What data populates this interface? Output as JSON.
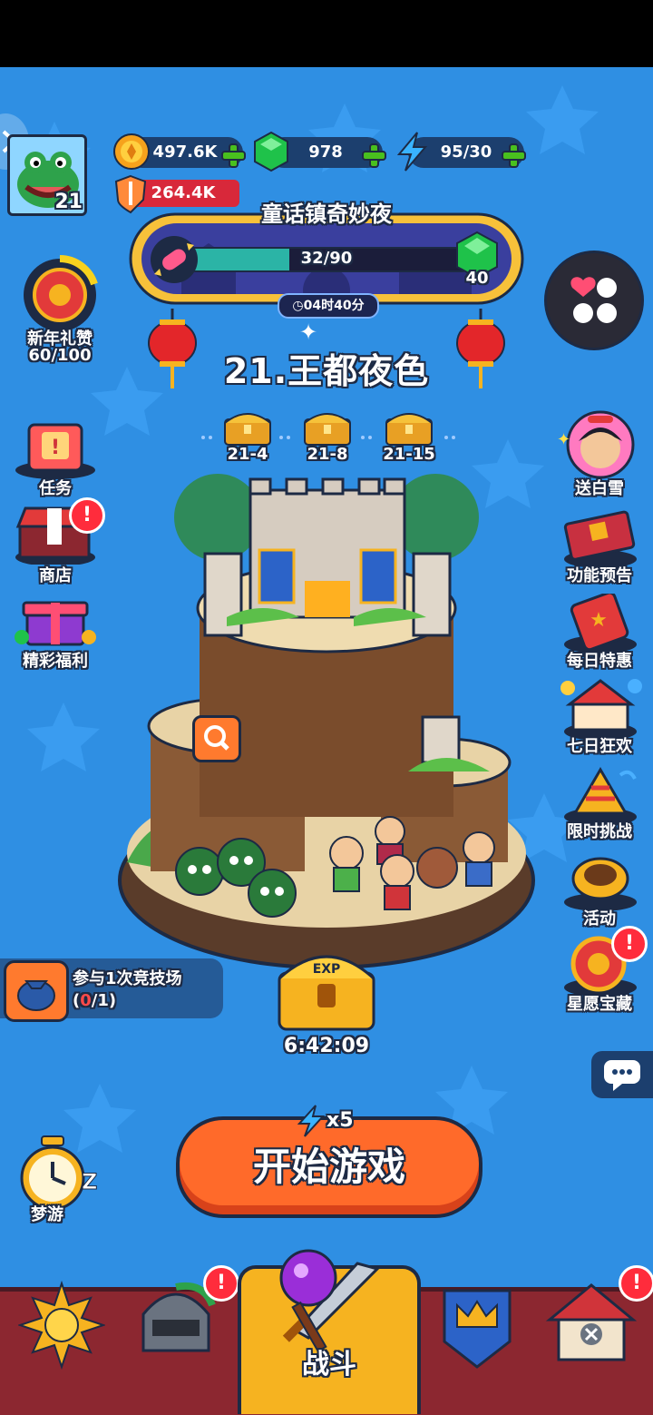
{
  "player": {
    "level": "21"
  },
  "resources": {
    "gold": "497.6K",
    "gems": "978",
    "energy": "95/30",
    "power": "264.4K"
  },
  "event": {
    "title": "童话镇奇妙夜",
    "progress": "32/90",
    "progress_fraction": 0.356,
    "reward_count": "40",
    "timer": "04时40分"
  },
  "new_year": {
    "label": "新年礼赞",
    "progress": "60/100"
  },
  "stage": {
    "title": "21.王都夜色",
    "chests": [
      "21-4",
      "21-8",
      "21-15"
    ]
  },
  "left_menu": [
    {
      "label": "任务",
      "icon": "quest-scroll-icon"
    },
    {
      "label": "商店",
      "icon": "shop-icon"
    },
    {
      "label": "精彩福利",
      "icon": "gift-box-icon"
    }
  ],
  "right_menu": [
    {
      "label": "送白雪",
      "icon": "snow-white-avatar-icon"
    },
    {
      "label": "功能预告",
      "icon": "book-icon"
    },
    {
      "label": "每日特惠",
      "icon": "ticket-icon"
    },
    {
      "label": "七日狂欢",
      "icon": "carnival-tent-icon"
    },
    {
      "label": "限时挑战",
      "icon": "party-hat-icon"
    },
    {
      "label": "活动",
      "icon": "drum-icon"
    },
    {
      "label": "星愿宝藏",
      "icon": "star-treasure-icon"
    }
  ],
  "quest_tip": {
    "text": "参与1次竞技场",
    "progress_current": "0",
    "progress_total": "/1)",
    "open_paren": "("
  },
  "idle_chest": {
    "timer": "6:42:09"
  },
  "start": {
    "label": "开始游戏",
    "cost": "x5"
  },
  "dream": {
    "label": "梦游"
  },
  "bottom_nav": {
    "battle_label": "战斗"
  },
  "colors": {
    "accent_orange": "#ff7a2e",
    "nav_red": "#8c2730",
    "sky_blue": "#2f8fe3"
  }
}
